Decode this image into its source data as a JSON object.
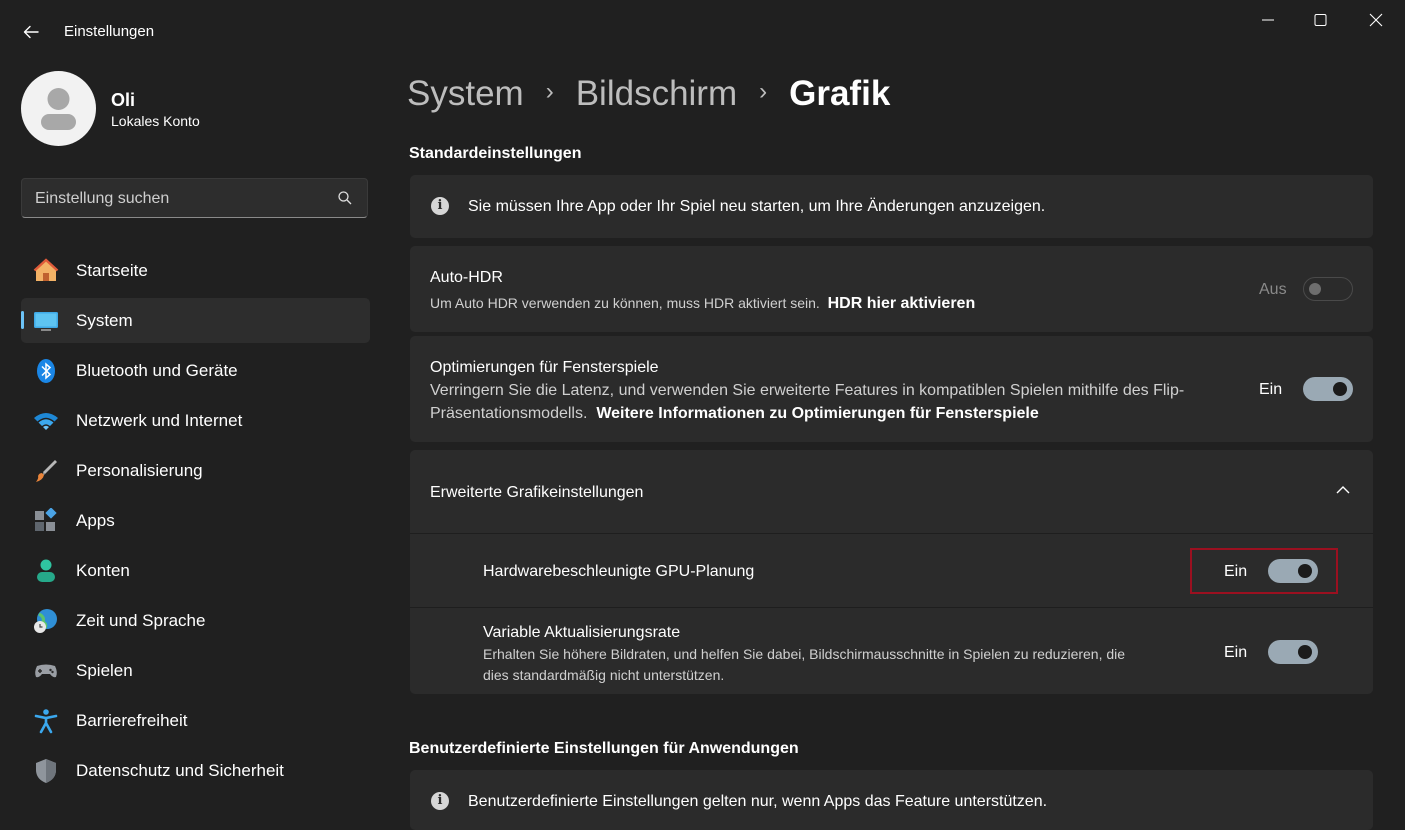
{
  "window": {
    "title": "Einstellungen"
  },
  "user": {
    "name": "Oli",
    "account_type": "Lokales Konto"
  },
  "search": {
    "placeholder": "Einstellung suchen"
  },
  "sidebar": {
    "items": [
      {
        "label": "Startseite",
        "icon": "home-icon"
      },
      {
        "label": "System",
        "icon": "monitor-icon",
        "active": true
      },
      {
        "label": "Bluetooth und Geräte",
        "icon": "bluetooth-icon"
      },
      {
        "label": "Netzwerk und Internet",
        "icon": "wifi-icon"
      },
      {
        "label": "Personalisierung",
        "icon": "brush-icon"
      },
      {
        "label": "Apps",
        "icon": "apps-icon"
      },
      {
        "label": "Konten",
        "icon": "person-icon"
      },
      {
        "label": "Zeit und Sprache",
        "icon": "globe-clock-icon"
      },
      {
        "label": "Spielen",
        "icon": "gamepad-icon"
      },
      {
        "label": "Barrierefreiheit",
        "icon": "accessibility-icon"
      },
      {
        "label": "Datenschutz und Sicherheit",
        "icon": "shield-icon"
      }
    ]
  },
  "breadcrumb": {
    "items": [
      "System",
      "Bildschirm"
    ],
    "current": "Grafik",
    "separator": "›"
  },
  "defaults": {
    "title": "Standardeinstellungen",
    "info": "Sie müssen Ihre App oder Ihr Spiel neu starten, um Ihre Änderungen anzuzeigen.",
    "auto_hdr": {
      "title": "Auto-HDR",
      "desc": "Um Auto HDR verwenden zu können, muss HDR aktiviert sein.",
      "link": "HDR hier aktivieren",
      "state": "Aus",
      "enabled": false
    },
    "windowed": {
      "title": "Optimierungen für Fensterspiele",
      "desc": "Verringern Sie die Latenz, und verwenden Sie erweiterte Features in kompatiblen Spielen mithilfe des Flip-Präsentationsmodells.",
      "link": "Weitere Informationen zu Optimierungen für Fensterspiele",
      "state": "Ein",
      "enabled": true
    },
    "advanced": {
      "title": "Erweiterte Grafikeinstellungen",
      "gpu": {
        "title": "Hardwarebeschleunigte GPU-Planung",
        "state": "Ein",
        "enabled": true
      },
      "vrr": {
        "title": "Variable Aktualisierungsrate",
        "desc_line1": "Erhalten Sie höhere Bildraten, und helfen Sie dabei, Bildschirmausschnitte in Spielen zu reduzieren, die",
        "desc_line2": "dies standardmäßig nicht unterstützen.",
        "state": "Ein",
        "enabled": true
      }
    }
  },
  "custom": {
    "title": "Benutzerdefinierte Einstellungen für Anwendungen",
    "info": "Benutzerdefinierte Einstellungen gelten nur, wenn Apps das Feature unterstützen."
  },
  "colors": {
    "background": "#202020",
    "card": "#2b2b2b",
    "accent": "#6cc3f7",
    "highlight": "#9b1020"
  }
}
